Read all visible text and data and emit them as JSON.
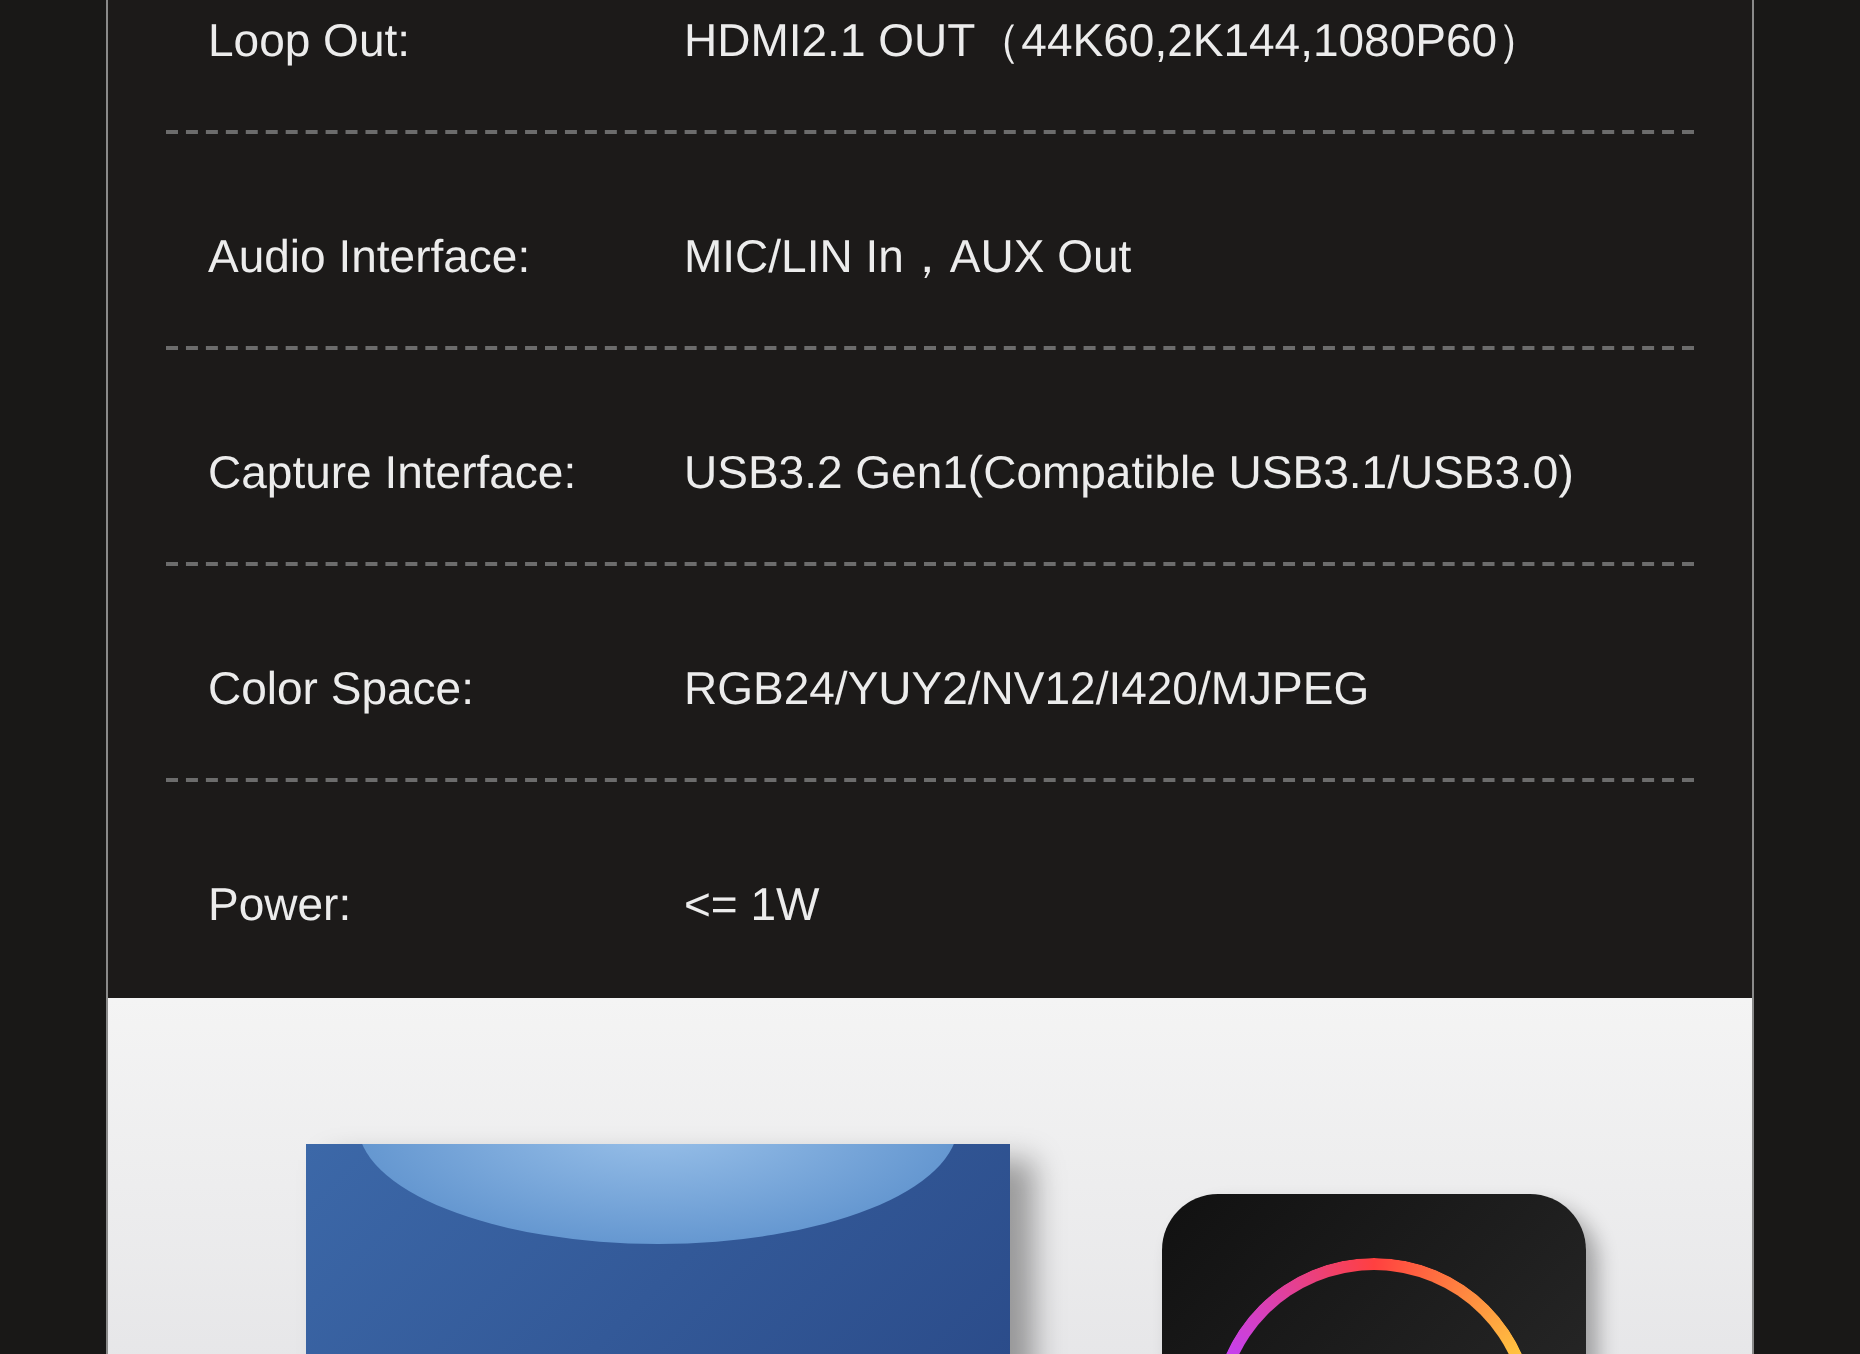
{
  "specs": [
    {
      "label": "Loop Out:",
      "value": "HDMI2.1 OUT（44K60,2K144,1080P60）"
    },
    {
      "label": "Audio Interface:",
      "value": "MIC/LIN In，AUX Out"
    },
    {
      "label": "Capture Interface:",
      "value": "USB3.2 Gen1(Compatible USB3.1/USB3.0)"
    },
    {
      "label": "Color Space:",
      "value": "RGB24/YUY2/NV12/I420/MJPEG"
    },
    {
      "label": "Power:",
      "value": "<= 1W"
    }
  ]
}
